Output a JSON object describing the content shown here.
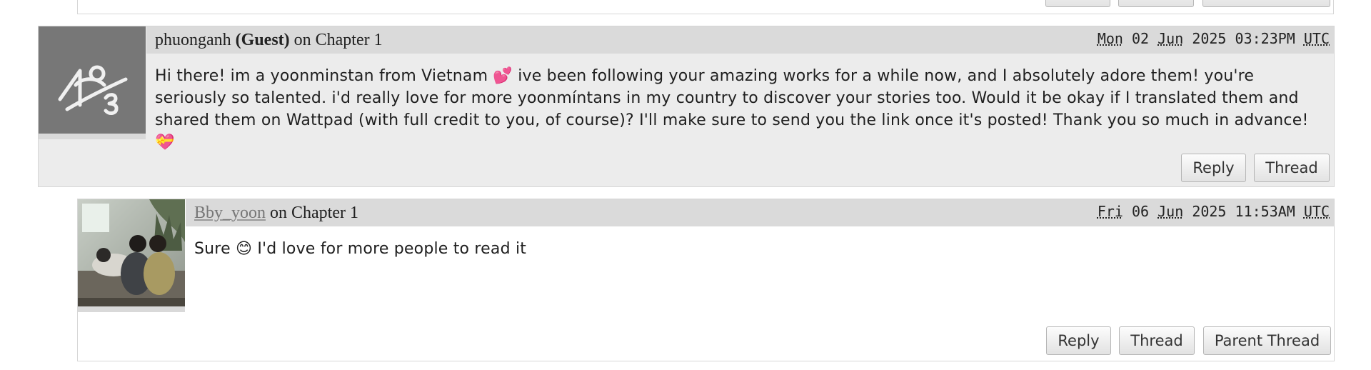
{
  "comments": [
    {
      "author": "phuonganh",
      "author_suffix": "(Guest)",
      "chapter_text": "on Chapter 1",
      "date": {
        "dow": "Mon",
        "day": "02",
        "month": "Jun",
        "year": "2025",
        "time": "03:23PM",
        "tz": "UTC"
      },
      "body": "Hi there! im a yoonminstan from Vietnam 💕 ive been following your amazing works for a while now, and I absolutely adore them! you're seriously so talented. i'd really love for more yoonmíntans in my country to discover your stories too. Would it be okay if I translated them and shared them on Wattpad (with full credit to you, of course)? I'll make sure to send you the link once it's posted! Thank you so much in advance! 💝",
      "buttons": {
        "reply": "Reply",
        "thread": "Thread"
      }
    },
    {
      "author": "Bby_yoon",
      "chapter_text": "on Chapter 1",
      "date": {
        "dow": "Fri",
        "day": "06",
        "month": "Jun",
        "year": "2025",
        "time": "11:53AM",
        "tz": "UTC"
      },
      "body": "Sure 😊 I'd love for more people to read it",
      "buttons": {
        "reply": "Reply",
        "thread": "Thread",
        "parent_thread": "Parent Thread"
      }
    }
  ],
  "colors": {
    "guest_background": "#ececec",
    "header_bar": "#dadada",
    "link_gray": "#777777"
  },
  "icons": {
    "guest_avatar": "anonymous-guest-icon",
    "user_avatar": "user-photo-avatar"
  }
}
